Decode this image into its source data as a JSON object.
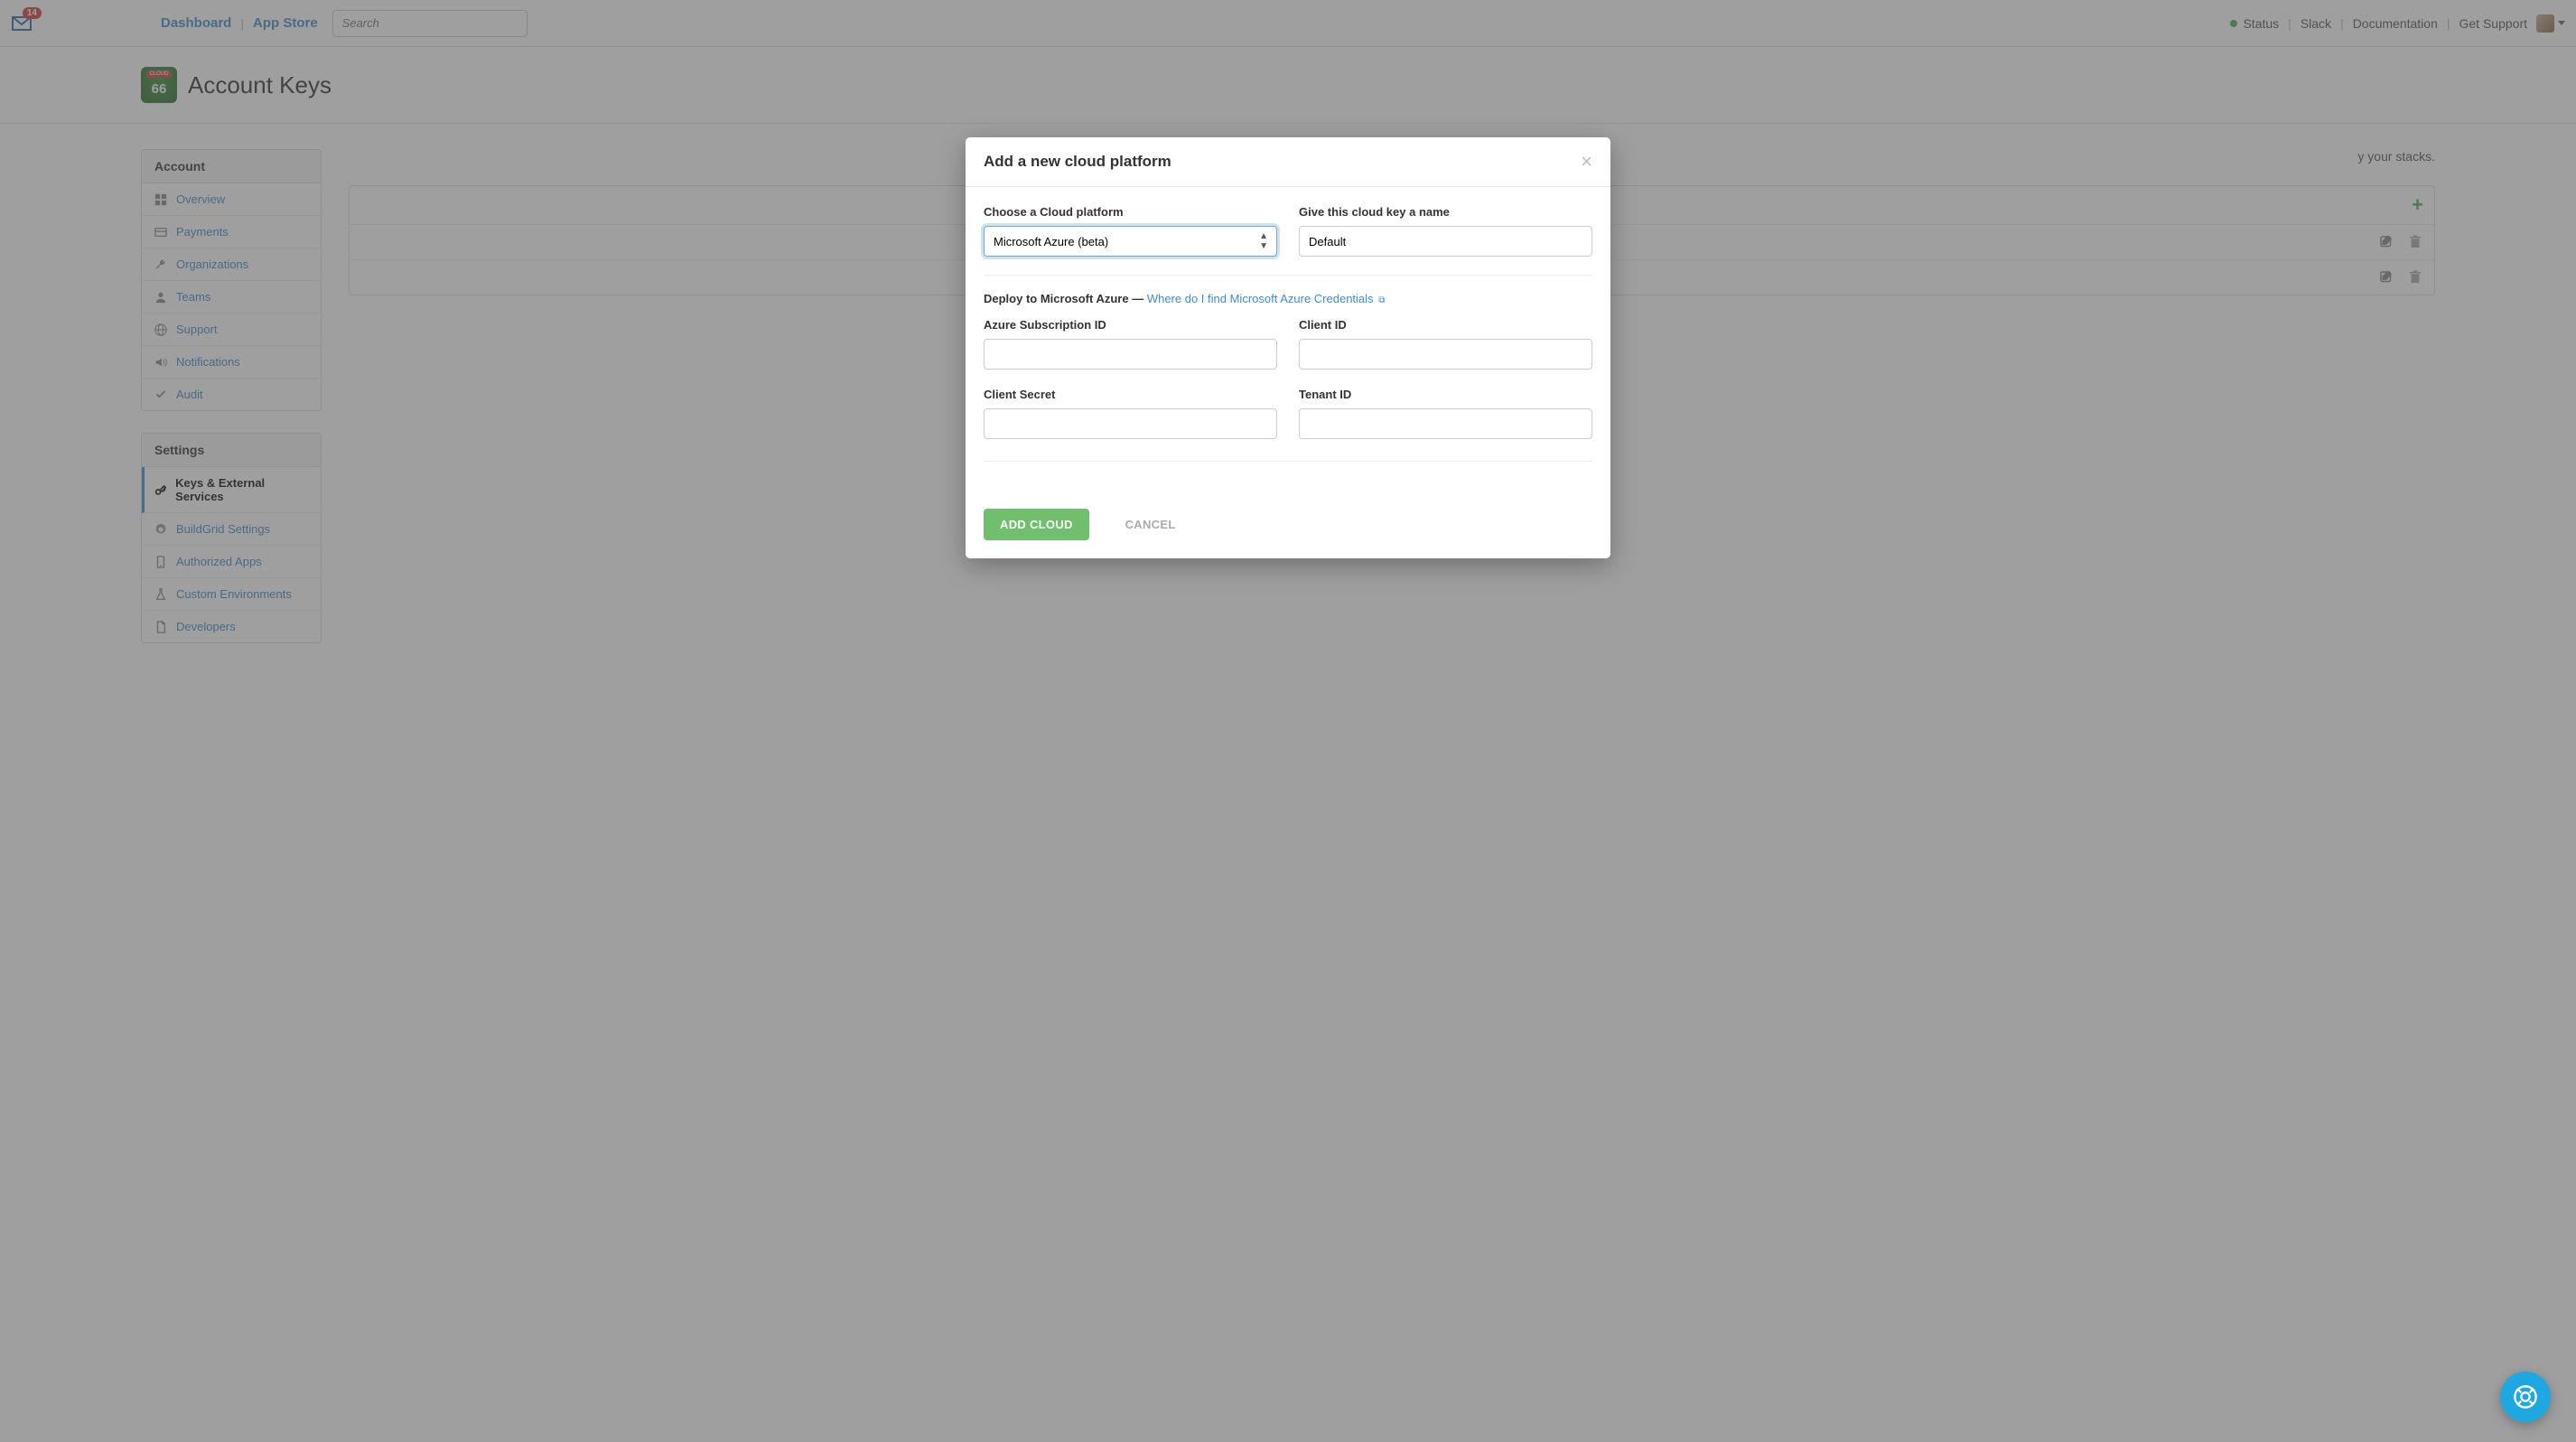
{
  "nav": {
    "mail_badge": "14",
    "dashboard": "Dashboard",
    "app_store": "App Store",
    "search_placeholder": "Search",
    "status": "Status",
    "slack": "Slack",
    "documentation": "Documentation",
    "get_support": "Get Support"
  },
  "page": {
    "title": "Account Keys",
    "content_desc_tail": "y your stacks."
  },
  "sidebar": {
    "account_header": "Account",
    "settings_header": "Settings",
    "account_items": [
      {
        "label": "Overview",
        "icon": "grid"
      },
      {
        "label": "Payments",
        "icon": "card"
      },
      {
        "label": "Organizations",
        "icon": "wrench"
      },
      {
        "label": "Teams",
        "icon": "user"
      },
      {
        "label": "Support",
        "icon": "globe"
      },
      {
        "label": "Notifications",
        "icon": "volume"
      },
      {
        "label": "Audit",
        "icon": "check"
      }
    ],
    "settings_items": [
      {
        "label": "Keys & External Services",
        "icon": "key",
        "active": true
      },
      {
        "label": "BuildGrid Settings",
        "icon": "gear"
      },
      {
        "label": "Authorized Apps",
        "icon": "phone"
      },
      {
        "label": "Custom Environments",
        "icon": "flask"
      },
      {
        "label": "Developers",
        "icon": "doc"
      }
    ]
  },
  "modal": {
    "title": "Add a new cloud platform",
    "platform_label": "Choose a Cloud platform",
    "platform_selected": "Microsoft Azure (beta)",
    "name_label": "Give this cloud key a name",
    "name_value": "Default",
    "deploy_prefix": "Deploy to Microsoft Azure —",
    "credentials_link": "Where do I find Microsoft Azure Credentials",
    "fields": {
      "subscription_id": "Azure Subscription ID",
      "client_id": "Client ID",
      "client_secret": "Client Secret",
      "tenant_id": "Tenant ID"
    },
    "add_button": "ADD CLOUD",
    "cancel_button": "CANCEL"
  }
}
